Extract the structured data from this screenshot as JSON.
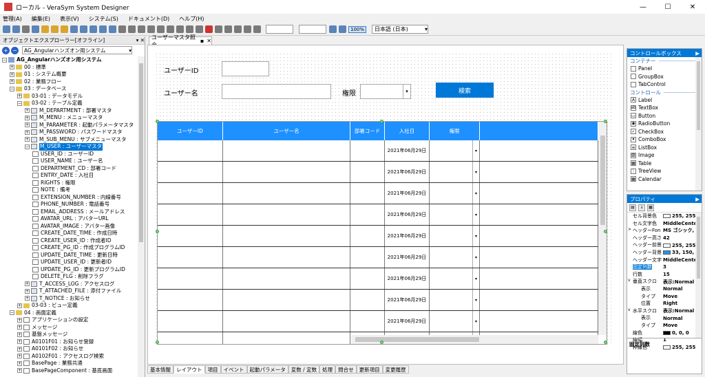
{
  "window": {
    "title": "ローカル - VeraSym System Designer"
  },
  "menu": [
    "管理(A)",
    "編集(E)",
    "表示(V)",
    "システム(S)",
    "ドキュメント(D)",
    "ヘルプ(H)"
  ],
  "toolbar": {
    "zoom_value": "100%",
    "language": "日本語 (日本)"
  },
  "explorer": {
    "title": "オブジェクトエクスプローラー[オフライン]",
    "system_select": "AG_Angularハンズオン用システム",
    "tree": [
      {
        "label": "AG_Angularハンズオン用システム",
        "level": 0,
        "icon": "root"
      },
      {
        "label": "00 : 標準",
        "level": 1,
        "icon": "folder"
      },
      {
        "label": "01 : システム概要",
        "level": 1,
        "icon": "folder"
      },
      {
        "label": "02 : 業務フロー",
        "level": 1,
        "icon": "folder"
      },
      {
        "label": "03 : データベース",
        "level": 1,
        "icon": "folder"
      },
      {
        "label": "03-01 : データモデル",
        "level": 2,
        "icon": "folder"
      },
      {
        "label": "03-02 : テーブル定義",
        "level": 2,
        "icon": "folder"
      },
      {
        "label": "M_DEPARTMENT : 部署マスタ",
        "level": 3,
        "icon": "table"
      },
      {
        "label": "M_MENU : メニューマスタ",
        "level": 3,
        "icon": "table"
      },
      {
        "label": "M_PARAMETER : 起動パラメータマスタ",
        "level": 3,
        "icon": "table"
      },
      {
        "label": "M_PASSWORD : パスワードマスタ",
        "level": 3,
        "icon": "table"
      },
      {
        "label": "M_SUB_MENU : サブメニューマスタ",
        "level": 3,
        "icon": "table"
      },
      {
        "label": "M_USER : ユーザーマスタ",
        "level": 3,
        "icon": "table",
        "selected": true
      },
      {
        "label": "USER_ID : ユーザーID",
        "level": 4,
        "icon": "column"
      },
      {
        "label": "USER_NAME : ユーザー名",
        "level": 4,
        "icon": "column"
      },
      {
        "label": "DEPARTMENT_CD : 部署コード",
        "level": 4,
        "icon": "column"
      },
      {
        "label": "ENTRY_DATE : 入社日",
        "level": 4,
        "icon": "column"
      },
      {
        "label": "RIGHTS : 権限",
        "level": 4,
        "icon": "column"
      },
      {
        "label": "NOTE : 備考",
        "level": 4,
        "icon": "column"
      },
      {
        "label": "EXTENSION_NUMBER : 内線番号",
        "level": 4,
        "icon": "column"
      },
      {
        "label": "PHONE_NUMBER : 電話番号",
        "level": 4,
        "icon": "column"
      },
      {
        "label": "EMAIL_ADDRESS : メールアドレス",
        "level": 4,
        "icon": "column"
      },
      {
        "label": "AVATAR_URL : アバターURL",
        "level": 4,
        "icon": "column"
      },
      {
        "label": "AVATAR_IMAGE : アバター画像",
        "level": 4,
        "icon": "column"
      },
      {
        "label": "CREATE_DATE_TIME : 作成日時",
        "level": 4,
        "icon": "column"
      },
      {
        "label": "CREATE_USER_ID : 作成者ID",
        "level": 4,
        "icon": "column"
      },
      {
        "label": "CREATE_PG_ID : 作成プログラムID",
        "level": 4,
        "icon": "column"
      },
      {
        "label": "UPDATE_DATE_TIME : 更新日時",
        "level": 4,
        "icon": "column"
      },
      {
        "label": "UPDATE_USER_ID : 更新者ID",
        "level": 4,
        "icon": "column"
      },
      {
        "label": "UPDATE_PG_ID : 更新プログラムID",
        "level": 4,
        "icon": "column"
      },
      {
        "label": "DELETE_FLG : 削除フラグ",
        "level": 4,
        "icon": "column"
      },
      {
        "label": "T_ACCESS_LOG : アクセスログ",
        "level": 3,
        "icon": "table"
      },
      {
        "label": "T_ATTACHED_FILE : 添付ファイル",
        "level": 3,
        "icon": "table"
      },
      {
        "label": "T_NOTICE : お知らせ",
        "level": 3,
        "icon": "table"
      },
      {
        "label": "03-03 : ビュー定義",
        "level": 2,
        "icon": "folder"
      },
      {
        "label": "04 : 画面定義",
        "level": 1,
        "icon": "folder"
      },
      {
        "label": "アプリケーションの設定",
        "level": 2,
        "icon": "doc"
      },
      {
        "label": "メッセージ",
        "level": 2,
        "icon": "doc"
      },
      {
        "label": "基盤メッセージ",
        "level": 2,
        "icon": "doc"
      },
      {
        "label": "A0101F01 : お知らせ登録",
        "level": 2,
        "icon": "doc"
      },
      {
        "label": "A0101F02 : お知らせ",
        "level": 2,
        "icon": "doc"
      },
      {
        "label": "A0102F01 : アクセスログ検索",
        "level": 2,
        "icon": "doc"
      },
      {
        "label": "BasePage : 業務共通",
        "level": 2,
        "icon": "doc"
      },
      {
        "label": "BasePageComponent : 基底画面",
        "level": 2,
        "icon": "doc"
      }
    ]
  },
  "document": {
    "tab_label": "ユーザーマスタ照会",
    "form": {
      "user_id_label": "ユーザーID",
      "user_name_label": "ユーザー名",
      "rights_label": "権限",
      "search_button": "検索"
    },
    "grid": {
      "columns": [
        "ユーザーID",
        "ユーザー名",
        "部署コード",
        "入社日",
        "権限"
      ],
      "row_date": "2021年06月29日",
      "row_count": 10
    },
    "bottom_tabs": [
      "基本情報",
      "レイアウト",
      "項目",
      "イベント",
      "起動パラメータ",
      "変数 / 定数",
      "処理",
      "問合せ",
      "更新項目",
      "変更履歴"
    ],
    "active_tab": "レイアウト"
  },
  "control_box": {
    "title": "コントロールボックス",
    "sections": [
      {
        "name": "コンテナー",
        "items": [
          "Panel",
          "GroupBox",
          "TabControl"
        ]
      },
      {
        "name": "コントロール",
        "items": [
          "Label",
          "TextBox",
          "Button",
          "RadioButton",
          "CheckBox",
          "ComboBox",
          "ListBox",
          "Image",
          "Table",
          "TreeView",
          "Calendar"
        ]
      }
    ]
  },
  "properties": {
    "title": "プロパティ",
    "rows": [
      {
        "name": "セル背景色",
        "value": "255, 255",
        "swatch": "#ffffff"
      },
      {
        "name": "セル文字色",
        "value": "MiddleCente"
      },
      {
        "name": "ヘッダーFon",
        "value": "MS ゴシック,",
        "expand": ">"
      },
      {
        "name": "ヘッダー高さ",
        "value": "42"
      },
      {
        "name": "ヘッダー前景",
        "value": "255, 255",
        "swatch": "#ffffff"
      },
      {
        "name": "ヘッダー背景",
        "value": "33, 150,",
        "swatch": "#2196f3"
      },
      {
        "name": "ヘッダー文字",
        "value": "MiddleCente"
      },
      {
        "name": "固定列数",
        "value": "3",
        "highlight": true
      },
      {
        "name": "行数",
        "value": "15"
      },
      {
        "name": "垂直スクロ",
        "value": "表示:Normal",
        "expand": "v"
      },
      {
        "name": "表示",
        "value": "Normal",
        "indent": true
      },
      {
        "name": "タイプ",
        "value": "Move",
        "indent": true
      },
      {
        "name": "位置",
        "value": "Right",
        "indent": true
      },
      {
        "name": "水平スクロ",
        "value": "表示:Normal",
        "expand": "v"
      },
      {
        "name": "表示",
        "value": "Normal",
        "indent": true
      },
      {
        "name": "タイプ",
        "value": "Move",
        "indent": true
      },
      {
        "name": "線色",
        "value": "0, 0, 0",
        "swatch": "#000000"
      },
      {
        "name": "線幅",
        "value": "1"
      },
      {
        "name": "枠線色",
        "value": "255, 255",
        "swatch": "#ffffff"
      }
    ],
    "description": "固定列数"
  },
  "colors": {
    "accent": "#0078d7",
    "grid_header": "#1e90ff"
  }
}
